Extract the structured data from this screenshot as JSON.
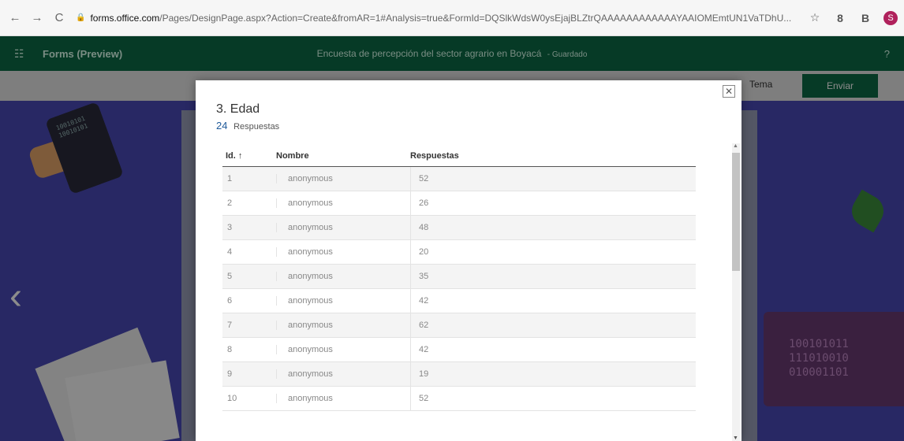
{
  "browser": {
    "url_host": "forms.office.com",
    "url_rest": "/Pages/DesignPage.aspx?Action=Create&fromAR=1#Analysis=true&FormId=DQSlkWdsW0ysEjajBLZtrQAAAAAAAAAAAAYAAIOMEmtUN1VaTDhU...",
    "profile_initial": "S"
  },
  "app": {
    "name": "Forms (Preview)",
    "doc_title": "Encuesta de percepción del sector agrario en Boyacá",
    "saved_label": "- Guardado",
    "help": "?",
    "tema_label": "Tema",
    "enviar_label": "Enviar"
  },
  "background": {
    "tablet_text": "10010101\n10010101",
    "screen_text": "100101011\n111010010\n010001101"
  },
  "modal": {
    "question_title": "3. Edad",
    "response_count": "24",
    "response_label": "Respuestas",
    "columns": {
      "id": "Id. ↑",
      "name": "Nombre",
      "responses": "Respuestas"
    },
    "rows": [
      {
        "id": "1",
        "name": "anonymous",
        "answer": "52"
      },
      {
        "id": "2",
        "name": "anonymous",
        "answer": "26"
      },
      {
        "id": "3",
        "name": "anonymous",
        "answer": "48"
      },
      {
        "id": "4",
        "name": "anonymous",
        "answer": "20"
      },
      {
        "id": "5",
        "name": "anonymous",
        "answer": "35"
      },
      {
        "id": "6",
        "name": "anonymous",
        "answer": "42"
      },
      {
        "id": "7",
        "name": "anonymous",
        "answer": "62"
      },
      {
        "id": "8",
        "name": "anonymous",
        "answer": "42"
      },
      {
        "id": "9",
        "name": "anonymous",
        "answer": "19"
      },
      {
        "id": "10",
        "name": "anonymous",
        "answer": "52"
      }
    ]
  }
}
